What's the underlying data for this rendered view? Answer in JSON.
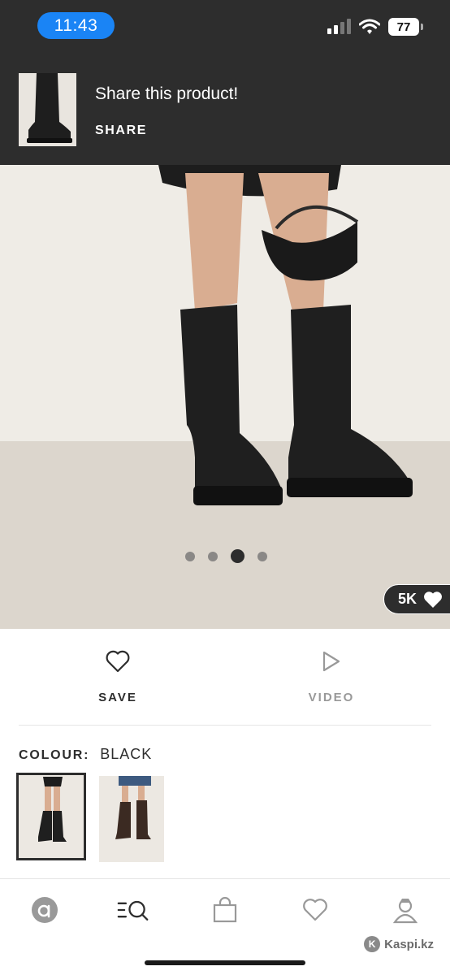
{
  "status_bar": {
    "time": "11:43",
    "battery": "77"
  },
  "share_banner": {
    "title": "Share this product!",
    "action_label": "SHARE"
  },
  "gallery": {
    "total_images": 4,
    "active_index": 2,
    "likes": "5K"
  },
  "actions": {
    "save_label": "SAVE",
    "video_label": "VIDEO"
  },
  "colour": {
    "label": "COLOUR:",
    "value": "BLACK",
    "swatches": [
      "black",
      "brown"
    ],
    "selected": 0
  },
  "bottom_nav": {
    "items": [
      "home-icon",
      "search-icon",
      "bag-icon",
      "saved-icon",
      "account-icon"
    ]
  },
  "watermark": {
    "text": "Kaspi.kz"
  },
  "colors": {
    "dark": "#2d2d2d",
    "accent": "#1a84f5"
  }
}
